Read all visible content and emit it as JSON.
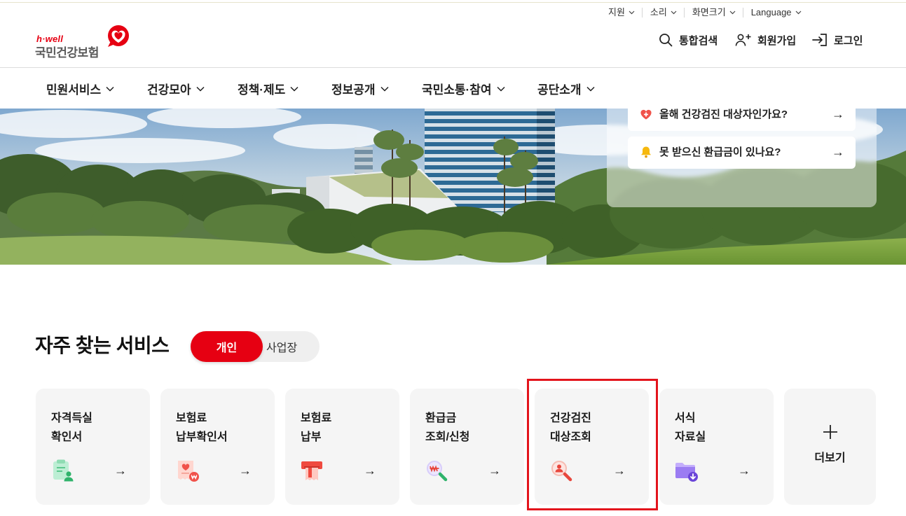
{
  "utility": [
    {
      "label": "지원"
    },
    {
      "label": "소리"
    },
    {
      "label": "화면크기"
    },
    {
      "label": "Language"
    }
  ],
  "logo": {
    "tagline": "h·well",
    "name": "국민건강보험",
    "icon": "heart-logo-icon"
  },
  "header_actions": {
    "search": {
      "label": "통합검색",
      "icon": "search-icon"
    },
    "join": {
      "label": "회원가입",
      "icon": "person-add-icon"
    },
    "login": {
      "label": "로그인",
      "icon": "login-icon"
    }
  },
  "nav": [
    {
      "label": "민원서비스"
    },
    {
      "label": "건강모아"
    },
    {
      "label": "정책·제도"
    },
    {
      "label": "정보공개"
    },
    {
      "label": "국민소통·참여"
    },
    {
      "label": "공단소개"
    }
  ],
  "hero": {
    "quick_links": [
      {
        "label": "올해 건강검진 대상자인가요?",
        "icon": "heart-plus-icon"
      },
      {
        "label": "못 받으신 환급금이 있나요?",
        "icon": "bell-icon"
      }
    ]
  },
  "ui": {
    "arrow": "→"
  },
  "services": {
    "title": "자주 찾는 서비스",
    "tabs": [
      {
        "label": "개인"
      },
      {
        "label": "사업장"
      }
    ],
    "active_tab": "개인",
    "cards": [
      {
        "line1": "자격득실",
        "line2": "확인서",
        "icon": "certificate-person-icon"
      },
      {
        "line1": "보험료",
        "line2": "납부확인서",
        "icon": "receipt-heart-icon"
      },
      {
        "line1": "보험료",
        "line2": "납부",
        "icon": "card-payment-icon"
      },
      {
        "line1": "환급금",
        "line2": "조회/신청",
        "icon": "refund-search-icon"
      },
      {
        "line1": "건강검진",
        "line2": "대상조회",
        "icon": "health-check-search-icon"
      },
      {
        "line1": "서식",
        "line2": "자료실",
        "icon": "folder-download-icon"
      }
    ],
    "more": {
      "label": "더보기",
      "icon": "plus-icon"
    },
    "highlighted_card": "건강검진 대상조회"
  },
  "colors": {
    "brand_red": "#e60012",
    "highlight_border": "#e3141c",
    "card_bg": "#f5f5f5",
    "toggle_bg": "#efefef"
  }
}
